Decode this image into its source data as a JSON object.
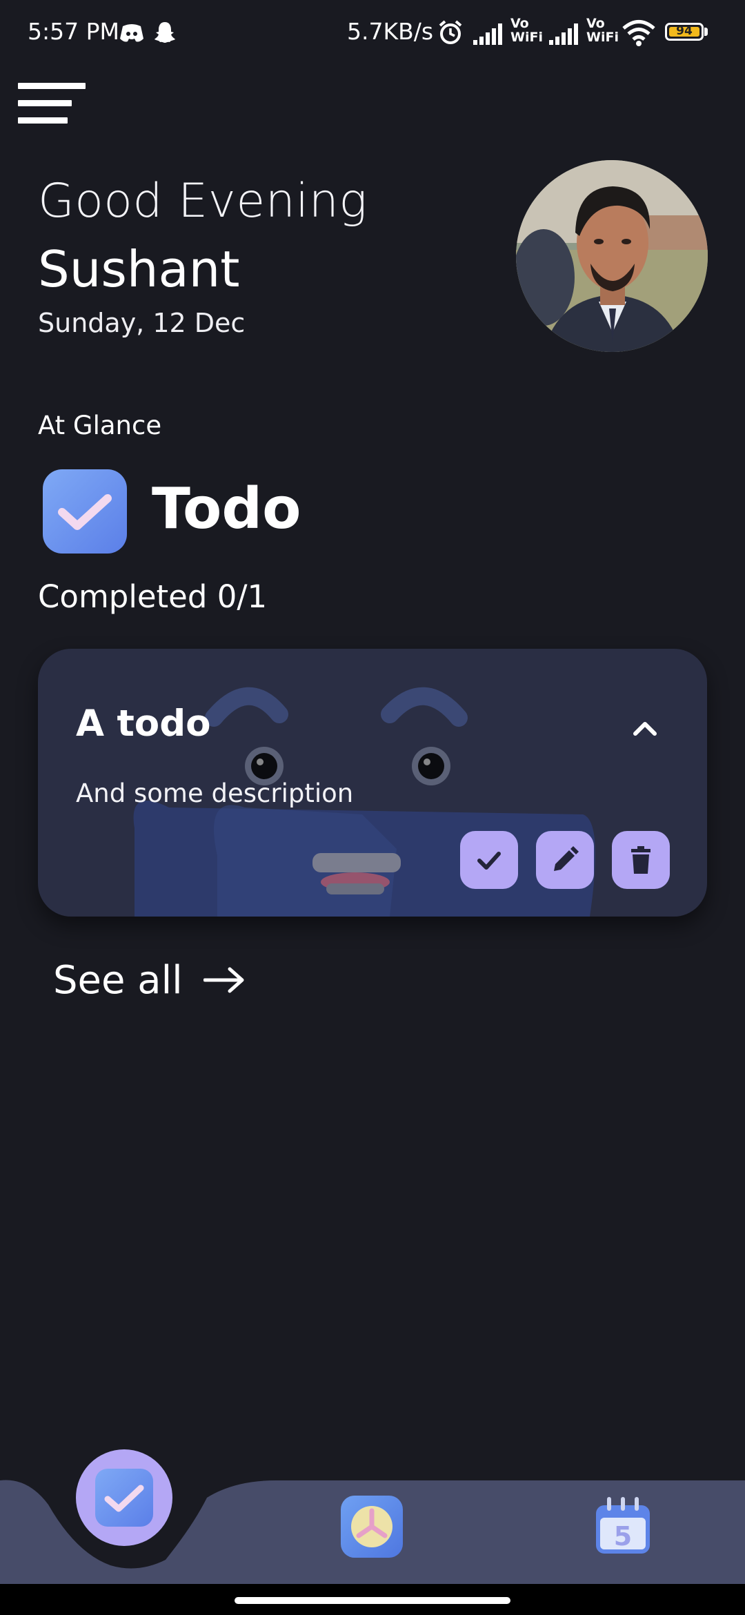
{
  "status_bar": {
    "time": "5:57 PM",
    "network_speed": "5.7KB/s",
    "battery_level": "94",
    "icons": [
      "discord-icon",
      "snapchat-icon",
      "alarm-icon",
      "signal-icon",
      "vowifi-icon",
      "signal-icon",
      "vowifi-icon",
      "wifi-icon",
      "battery-icon"
    ],
    "vowifi_label_top": "Vo",
    "vowifi_label_bottom": "WiFi"
  },
  "header": {
    "greeting": "Good Evening",
    "user_name": "Sushant",
    "date": "Sunday, 12 Dec"
  },
  "glance": {
    "section_label": "At Glance",
    "todo_title": "Todo",
    "completed_text": "Completed 0/1"
  },
  "todo_card": {
    "title": "A todo",
    "description": "And some description"
  },
  "see_all": {
    "label": "See all"
  },
  "bottom_nav": {
    "items": [
      "todo-icon",
      "clock-icon",
      "calendar-icon"
    ],
    "calendar_day": "5"
  },
  "colors": {
    "background": "#191a21",
    "card": "#2a2e44",
    "accent": "#b4a7f5",
    "nav_bar": "#474c69",
    "battery": "#f2b91c"
  }
}
